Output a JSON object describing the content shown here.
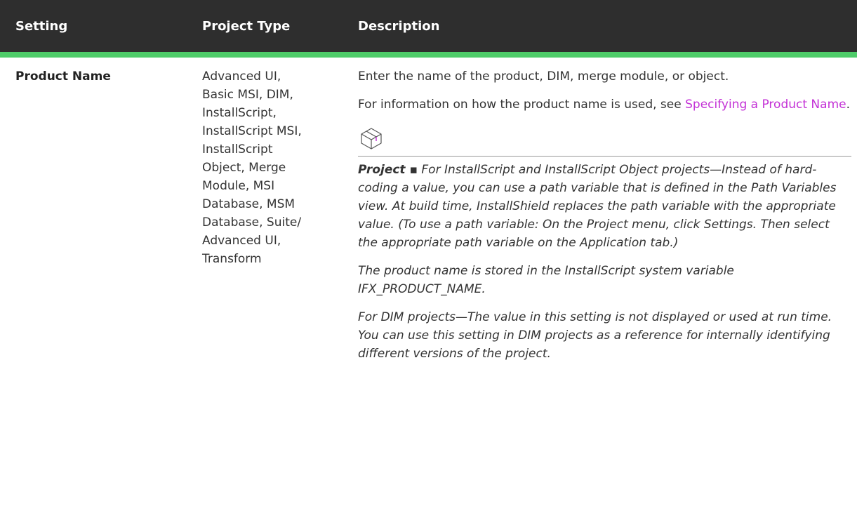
{
  "table": {
    "headers": {
      "setting": "Setting",
      "project_type": "Project Type",
      "description": "Description"
    },
    "rows": [
      {
        "setting": "Product Name",
        "project_type_lines": [
          "Advanced UI,",
          "Basic MSI, DIM,",
          "InstallScript,",
          "InstallScript MSI,",
          "InstallScript",
          "Object, Merge",
          "Module, MSI",
          "Database, MSM",
          "Database, Suite/",
          "Advanced UI,",
          "Transform"
        ],
        "description": {
          "p1": "Enter the name of the product, DIM, merge module, or object.",
          "p2_before": "For information on how the product name is used, see ",
          "p2_link": "Specifying a Product Name",
          "p2_after": ".",
          "note_icon": "package-box-icon",
          "note_label": "Project ▪",
          "note_p1": " For InstallScript and InstallScript Object projects—Instead of hard-coding a value, you can use a path variable that is defined in the Path Variables view. At build time, InstallShield replaces the path variable with the appropriate value. (To use a path variable: On the Project menu, click Settings. Then select the appropriate path variable on the Application tab.)",
          "note_p2": "The product name is stored in the InstallScript system variable IFX_PRODUCT_NAME.",
          "note_p3": "For DIM projects—The value in this setting is not displayed or used at run time. You can use this setting in DIM projects as a reference for internally identifying different versions of the project."
        }
      }
    ]
  },
  "colors": {
    "header_bg": "#2e2e2e",
    "header_accent": "#4ecc69",
    "link": "#c331d6"
  }
}
